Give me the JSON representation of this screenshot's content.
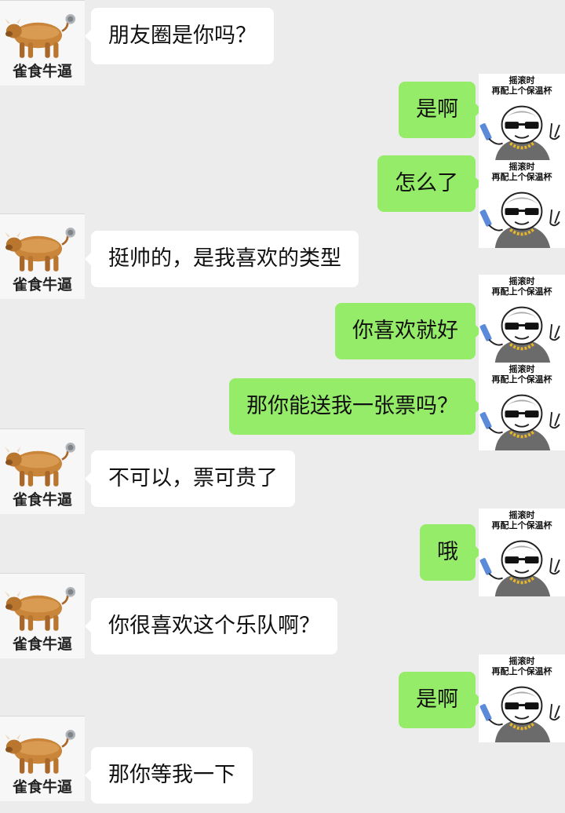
{
  "contact": {
    "name_label": "雀食牛逼",
    "avatar_icon": "ox-icon"
  },
  "self": {
    "sticker_caption_line1": "摇滚时",
    "sticker_caption_line2": "再配上个保温杯",
    "avatar_icon": "sunglasses-meme-avatar"
  },
  "messages": [
    {
      "from": "contact",
      "text": "朋友圈是你吗？"
    },
    {
      "from": "self",
      "text": "是啊"
    },
    {
      "from": "self",
      "text": "怎么了"
    },
    {
      "from": "contact",
      "text": "挺帅的，是我喜欢的类型"
    },
    {
      "from": "self",
      "text": "你喜欢就好"
    },
    {
      "from": "self",
      "text": "那你能送我一张票吗？"
    },
    {
      "from": "contact",
      "text": "不可以，票可贵了"
    },
    {
      "from": "self",
      "text": "哦"
    },
    {
      "from": "contact",
      "text": "你很喜欢这个乐队啊？"
    },
    {
      "from": "self",
      "text": "是啊"
    },
    {
      "from": "contact",
      "text": "那你等我一下"
    }
  ],
  "colors": {
    "background": "#ececec",
    "incoming_bubble": "#ffffff",
    "outgoing_bubble": "#95ec69"
  }
}
